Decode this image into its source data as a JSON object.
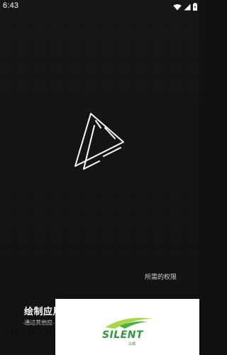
{
  "status_bar": {
    "time": "6:43",
    "icons": [
      "wifi-icon",
      "signal-icon",
      "battery-icon"
    ]
  },
  "logo": {
    "icon": "play-triangle-logo-icon",
    "color": "#ffffff"
  },
  "permissions_link": {
    "label": "所需的权限"
  },
  "action": {
    "title": "绘制应用程序",
    "subtitle": "通过其他应",
    "icon": "arrow-right-icon"
  },
  "watermark": {
    "wordmark": "SILENT",
    "sub_text": "白鹭",
    "color": "#2f9a3a"
  }
}
